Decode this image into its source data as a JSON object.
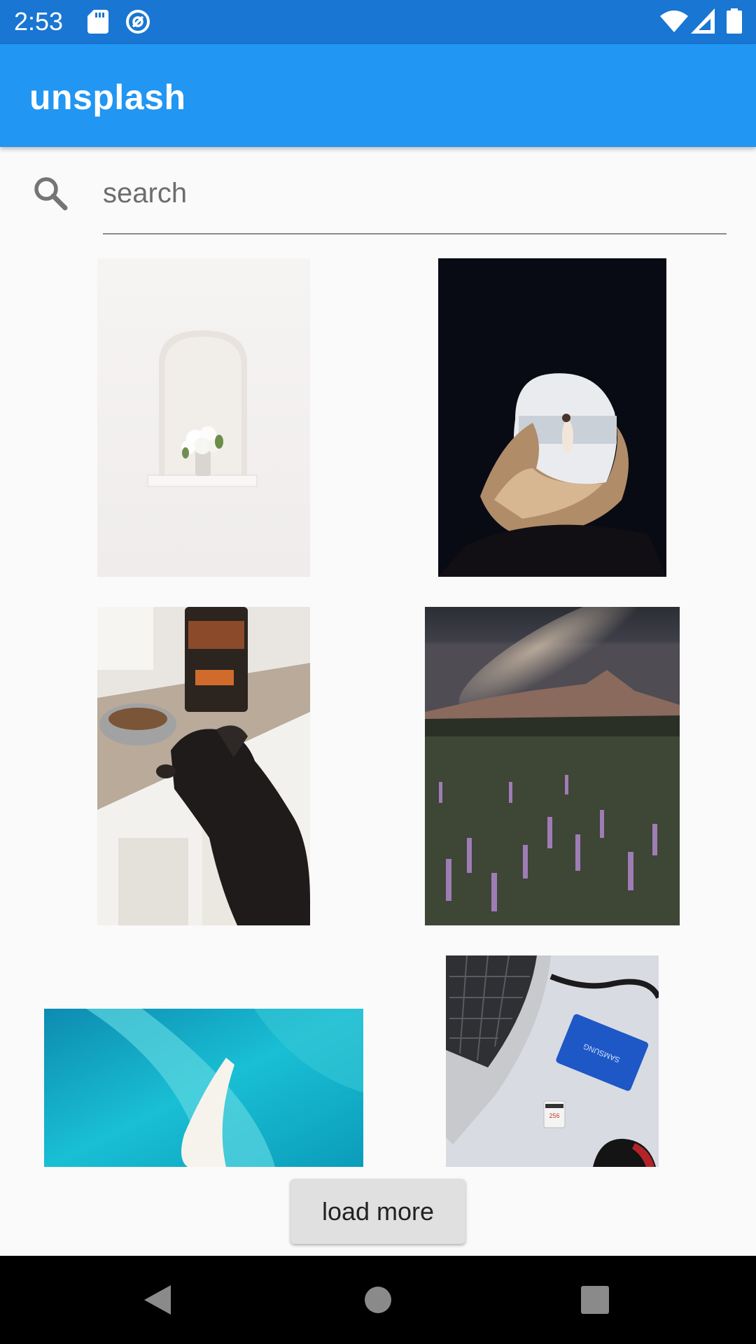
{
  "status_bar": {
    "time": "2:53",
    "left_icons": [
      "sd-card-icon",
      "sync-icon"
    ],
    "right_icons": [
      "wifi-icon",
      "signal-icon",
      "battery-icon"
    ]
  },
  "app_bar": {
    "title": "unsplash"
  },
  "search": {
    "placeholder": "search",
    "value": "",
    "icon": "search-icon"
  },
  "photos": [
    {
      "subject": "white arched niche with flowers"
    },
    {
      "subject": "person in sea cave opening"
    },
    {
      "subject": "dog eating from bowl in kitchen"
    },
    {
      "subject": "milky way over mountains and lupine field"
    },
    {
      "subject": "aerial turquoise sea with sandbar"
    },
    {
      "subject": "laptop with blue samsung SSD",
      "ssd_label": "SAMSUNG",
      "card_label": "256"
    }
  ],
  "load_more": {
    "label": "load more"
  },
  "nav_bar": {
    "icons": [
      "back-icon",
      "home-icon",
      "recents-icon"
    ]
  },
  "colors": {
    "status_bar": "#1976d2",
    "app_bar": "#2196f3",
    "background": "#fafafa",
    "button": "#e0e0e0"
  }
}
